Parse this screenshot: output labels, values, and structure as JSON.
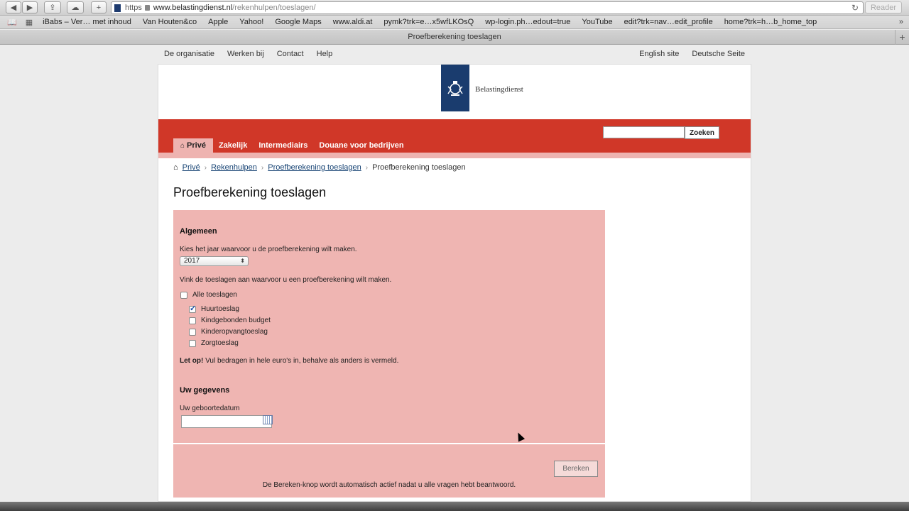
{
  "browser": {
    "scheme": "https",
    "url_host": "www.belastingdienst.nl",
    "url_path": "/rekenhulpen/toeslagen/",
    "reader_label": "Reader",
    "tab_title": "Proefberekening toeslagen",
    "bookmarks": [
      "iBabs – Ver… met inhoud",
      "Van Houten&co",
      "Apple",
      "Yahoo!",
      "Google Maps",
      "www.aldi.at",
      "pymk?trk=e…x5wfLKOsQ",
      "wp-login.ph…edout=true",
      "YouTube",
      "edit?trk=nav…edit_profile",
      "home?trk=h…b_home_top"
    ]
  },
  "topnav": {
    "left": [
      "De organisatie",
      "Werken bij",
      "Contact",
      "Help"
    ],
    "right": [
      "English site",
      "Deutsche Seite"
    ]
  },
  "header": {
    "brand": "Belastingdienst",
    "search_button": "Zoeken",
    "tabs": [
      "Privé",
      "Zakelijk",
      "Intermediairs",
      "Douane voor bedrijven"
    ]
  },
  "breadcrumb": [
    "Privé",
    "Rekenhulpen",
    "Proefberekening toeslagen",
    "Proefberekening toeslagen"
  ],
  "page_title": "Proefberekening toeslagen",
  "form": {
    "section1_title": "Algemeen",
    "year_label": "Kies het jaar waarvoor u de proefberekening wilt maken.",
    "year_value": "2017",
    "toeslagen_label": "Vink de toeslagen aan waarvoor u een proefberekening wilt maken.",
    "alle_toeslagen": "Alle toeslagen",
    "options": [
      {
        "label": "Huurtoeslag",
        "checked": true
      },
      {
        "label": "Kindgebonden budget",
        "checked": false
      },
      {
        "label": "Kinderopvangtoeslag",
        "checked": false
      },
      {
        "label": "Zorgtoeslag",
        "checked": false
      }
    ],
    "letop_bold": "Let op!",
    "letop_text": " Vul bedragen in hele euro's in, behalve als anders is vermeld.",
    "section2_title": "Uw gegevens",
    "birthdate_label": "Uw geboortedatum",
    "bereken_button": "Bereken",
    "footer_text": "De Bereken-knop wordt automatisch actief nadat u alle vragen hebt beantwoord."
  }
}
